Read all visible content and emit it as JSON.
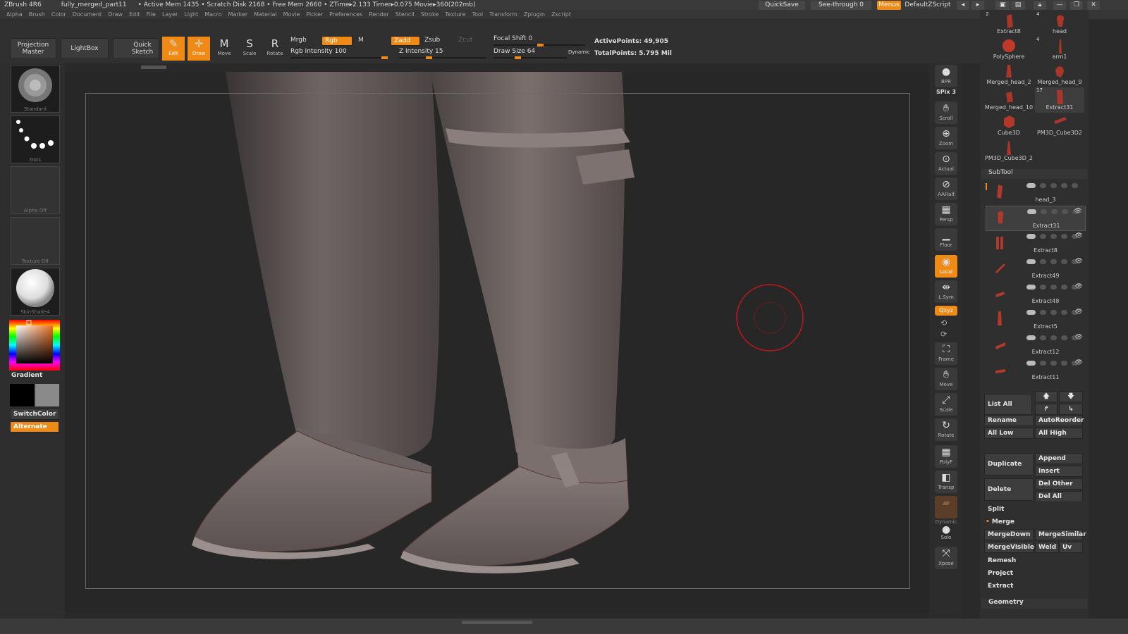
{
  "titlebar": {
    "app": "ZBrush 4R6",
    "file": "fully_merged_part11",
    "stats": "• Active Mem 1435 • Scratch Disk 2168 • Free Mem 2660 • ZTime▸2.133 Timer▸0.075 Movie▸360(202mb)",
    "quicksave": "QuickSave",
    "seethrough": "See-through 0",
    "menus": "Menus",
    "script": "DefaultZScript"
  },
  "menubar": [
    "Alpha",
    "Brush",
    "Color",
    "Document",
    "Draw",
    "Edit",
    "File",
    "Layer",
    "Light",
    "Macro",
    "Marker",
    "Material",
    "Movie",
    "Picker",
    "Preferences",
    "Render",
    "Stencil",
    "Stroke",
    "Texture",
    "Tool",
    "Transform",
    "Zplugin",
    "Zscript"
  ],
  "toolbar": {
    "projection_master": "Projection Master",
    "lightbox": "LightBox",
    "quick_sketch": "Quick Sketch",
    "edit": "Edit",
    "draw": "Draw",
    "move": "Move",
    "scale": "Scale",
    "rotate": "Rotate",
    "mrgb": "Mrgb",
    "rgb": "Rgb",
    "m": "M",
    "zadd": "Zadd",
    "zsub": "Zsub",
    "zcut": "Zcut",
    "rgb_intensity": "Rgb Intensity 100",
    "z_intensity": "Z Intensity 15",
    "focal_shift": "Focal Shift 0",
    "draw_size": "Draw Size 64",
    "dynamic": "Dynamic",
    "active_points": "ActivePoints: 49,905",
    "total_points": "TotalPoints: 5.795 Mil"
  },
  "leftshelf": {
    "brush": "Standard",
    "stroke": "Dots",
    "alpha": "Alpha Off",
    "texture": "Texture Off",
    "material": "SkinShade4",
    "gradient": "Gradient",
    "switchcolor": "SwitchColor",
    "alternate": "Alternate"
  },
  "rightshelf": {
    "bpr": "BPR",
    "spix": "SPix 3",
    "scroll": "Scroll",
    "zoom": "Zoom",
    "actual": "Actual",
    "aahalf": "AAHalf",
    "persp": "Persp",
    "floor": "Floor",
    "local": "Local",
    "lsym": "L.Sym",
    "xyz": "Qxyz",
    "frame": "Frame",
    "move": "Move",
    "scale": "Scale",
    "rotate": "Rotate",
    "polyf": "PolyF",
    "transp": "Transp",
    "dynamic": "Dynamic",
    "solo": "Solo",
    "xpose": "Xpose"
  },
  "tools": [
    {
      "label": "Extract8",
      "count": "2"
    },
    {
      "label": "head",
      "count": "4"
    },
    {
      "label": "PolySphere",
      "count": ""
    },
    {
      "label": "arm1",
      "count": "4"
    },
    {
      "label": "Merged_head_2",
      "count": ""
    },
    {
      "label": "Merged_head_9",
      "count": ""
    },
    {
      "label": "Merged_head_10",
      "count": ""
    },
    {
      "label": "Extract31",
      "count": "17"
    },
    {
      "label": "Cube3D",
      "count": ""
    },
    {
      "label": "PM3D_Cube3D2",
      "count": ""
    },
    {
      "label": "PM3D_Cube3D_2",
      "count": ""
    }
  ],
  "subtool": {
    "header": "SubTool",
    "items": [
      "head_3",
      "Extract31",
      "Extract8",
      "Extract49",
      "Extract48",
      "Extract5",
      "Extract12",
      "Extract11"
    ],
    "list_all": "List All",
    "rename": "Rename",
    "autoreorder": "AutoReorder",
    "all_low": "All Low",
    "all_high": "All High",
    "duplicate": "Duplicate",
    "append": "Append",
    "insert": "Insert",
    "delete": "Delete",
    "del_other": "Del Other",
    "del_all": "Del All",
    "split": "Split",
    "merge": "Merge",
    "mergedown": "MergeDown",
    "mergesimilar": "MergeSimilar",
    "mergevisible": "MergeVisible",
    "weld": "Weld",
    "uv": "Uv",
    "remesh": "Remesh",
    "project": "Project",
    "extract": "Extract",
    "geometry": "Geometry"
  },
  "colors": {
    "accent": "#f08a17",
    "mesh": "#6e6362",
    "brush_ring": "#c01818"
  }
}
